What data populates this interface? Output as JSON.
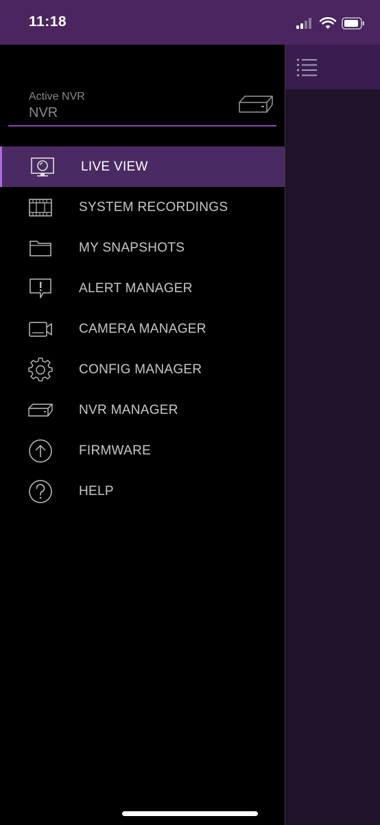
{
  "status_bar": {
    "time": "11:18"
  },
  "drawer": {
    "nvr": {
      "label": "Active NVR",
      "value": "NVR"
    },
    "menu": [
      {
        "label": "LIVE VIEW",
        "icon": "monitor-icon",
        "active": true
      },
      {
        "label": "SYSTEM RECORDINGS",
        "icon": "film-strip-icon",
        "active": false
      },
      {
        "label": "MY SNAPSHOTS",
        "icon": "folder-icon",
        "active": false
      },
      {
        "label": "ALERT MANAGER",
        "icon": "alert-bubble-icon",
        "active": false
      },
      {
        "label": "CAMERA MANAGER",
        "icon": "video-camera-icon",
        "active": false
      },
      {
        "label": "CONFIG MANAGER",
        "icon": "gear-icon",
        "active": false
      },
      {
        "label": "NVR MANAGER",
        "icon": "nvr-device-icon",
        "active": false
      },
      {
        "label": "FIRMWARE",
        "icon": "upload-circle-icon",
        "active": false
      },
      {
        "label": "HELP",
        "icon": "help-circle-icon",
        "active": false
      }
    ]
  },
  "colors": {
    "status_bar_bg": "#4a2560",
    "active_item_bg": "#4a2a63",
    "accent": "#8e44b8",
    "text": "#c8c8c8"
  }
}
